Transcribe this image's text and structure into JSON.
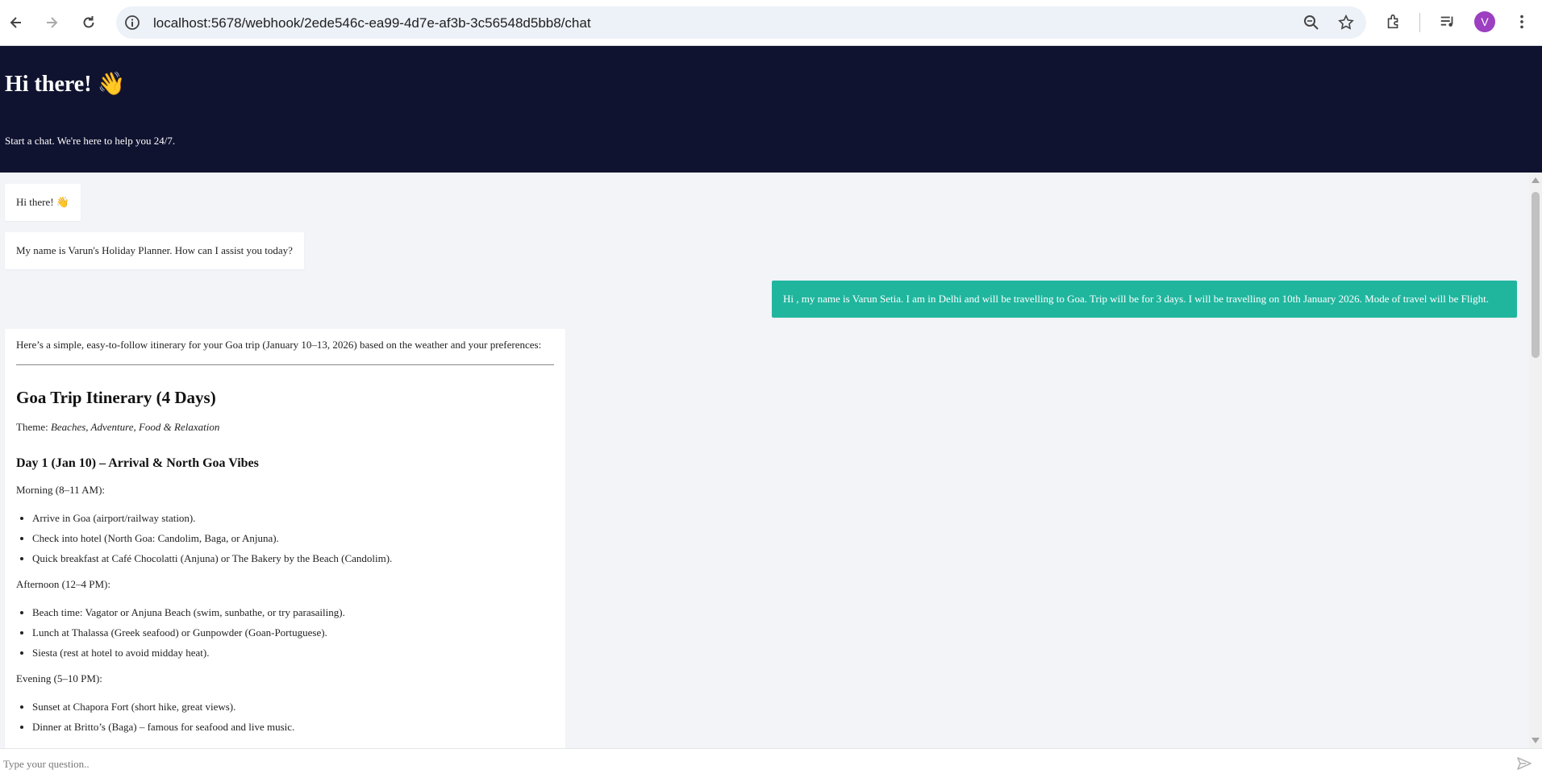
{
  "browser": {
    "url": "localhost:5678/webhook/2ede546c-ea99-4d7e-af3b-3c56548d5bb8/chat",
    "avatar_letter": "V",
    "avatar_color": "#9c3fc1"
  },
  "header": {
    "title": "Hi there! 👋",
    "subtitle": "Start a chat. We're here to help you 24/7.",
    "background": "#101330"
  },
  "messages": {
    "bot_greeting": "Hi there! 👋",
    "bot_intro": "My name is Varun's Holiday Planner. How can I assist you today?",
    "user_message": "Hi , my name is Varun Setia. I am in Delhi and will be travelling to Goa. Trip will be for 3 days. I will be travelling on 10th January 2026. Mode of travel will be Flight.",
    "user_bubble_color": "#20b69e",
    "itinerary": {
      "intro": "Here’s a simple, easy-to-follow itinerary for your Goa trip (January 10–13, 2026) based on the weather and your preferences:",
      "title": "Goa Trip Itinerary (4 Days)",
      "theme_label": "Theme: ",
      "theme_value": "Beaches, Adventure, Food & Relaxation",
      "day1_title": "Day 1 (Jan 10) – Arrival & North Goa Vibes",
      "morning_label": "Morning (8–11 AM):",
      "morning_items": [
        "Arrive in Goa (airport/railway station).",
        "Check into hotel (North Goa: Candolim, Baga, or Anjuna).",
        "Quick breakfast at Café Chocolatti (Anjuna) or The Bakery by the Beach (Candolim)."
      ],
      "afternoon_label": "Afternoon (12–4 PM):",
      "afternoon_items": [
        "Beach time: Vagator or Anjuna Beach (swim, sunbathe, or try parasailing).",
        "Lunch at Thalassa (Greek seafood) or Gunpowder (Goan-Portuguese).",
        "Siesta (rest at hotel to avoid midday heat)."
      ],
      "evening_label": "Evening (5–10 PM):",
      "evening_items": [
        "Sunset at Chapora Fort (short hike, great views).",
        "Dinner at Britto’s (Baga) – famous for seafood and live music."
      ]
    }
  },
  "input": {
    "placeholder": "Type your question.."
  }
}
